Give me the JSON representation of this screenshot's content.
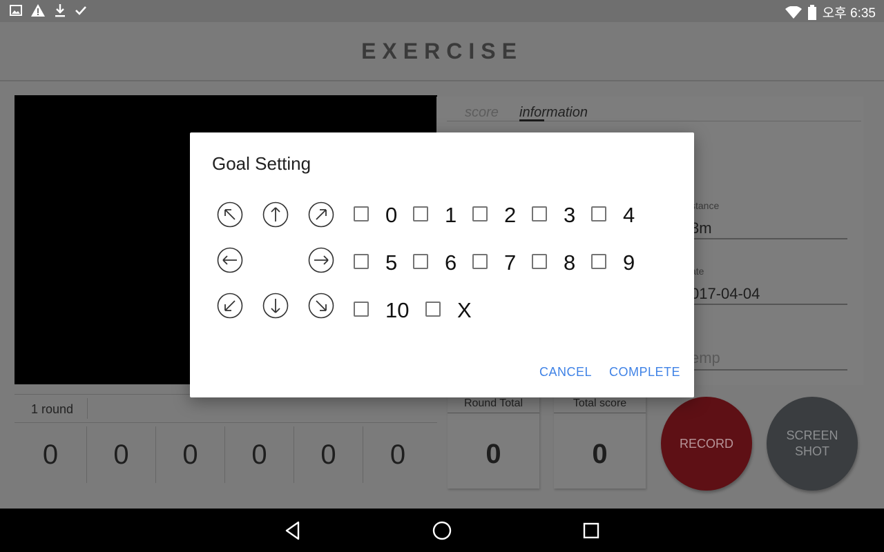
{
  "status_bar": {
    "icons": [
      "image-icon",
      "warning-icon",
      "download-icon",
      "check-icon"
    ],
    "right_icons": [
      "wifi-icon",
      "battery-icon"
    ],
    "time": "오후 6:35"
  },
  "app_bar": {
    "title": "EXERCISE"
  },
  "info_panel": {
    "tabs": [
      {
        "label": "score",
        "active": false
      },
      {
        "label": "information",
        "active": true
      }
    ],
    "fields": [
      {
        "label": "stance",
        "value": "3m",
        "placeholder": false
      },
      {
        "label": "ate",
        "value": "017-04-04",
        "placeholder": false
      },
      {
        "label": "",
        "value": "emp",
        "placeholder": true
      }
    ]
  },
  "round": {
    "label": "1 round",
    "scores": [
      "0",
      "0",
      "0",
      "0",
      "0",
      "0"
    ]
  },
  "totals": {
    "round_total_label": "Round Total",
    "round_total_value": "0",
    "total_score_label": "Total score",
    "total_score_value": "0"
  },
  "buttons": {
    "record": "RECORD",
    "screenshot_line1": "SCREEN",
    "screenshot_line2": "SHOT"
  },
  "dialog": {
    "title": "Goal Setting",
    "arrows": [
      "up-left",
      "up",
      "up-right",
      "left",
      "right",
      "down-left",
      "down",
      "down-right"
    ],
    "options": [
      "0",
      "1",
      "2",
      "3",
      "4",
      "5",
      "6",
      "7",
      "8",
      "9",
      "10",
      "X"
    ],
    "cancel": "CANCEL",
    "complete": "COMPLETE"
  },
  "colors": {
    "accent": "#3f82e6",
    "record": "#b71c1c",
    "screenshot": "#55595e",
    "scrim": "#7b7b7b"
  },
  "nav_bar": {
    "icons": [
      "back-icon",
      "home-icon",
      "recents-icon"
    ]
  }
}
